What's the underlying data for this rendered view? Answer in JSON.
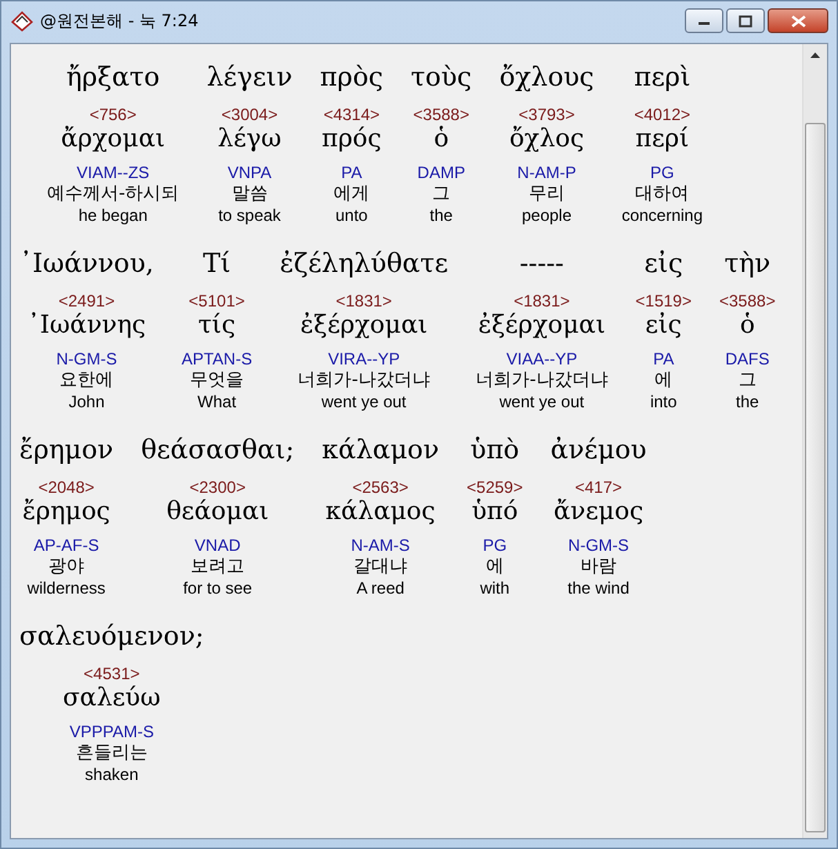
{
  "window": {
    "title": "@원전본해 - 눅 7:24"
  },
  "lines": [
    [
      {
        "greek": "ἤρξατο",
        "strong": "<756>",
        "lemma": "ἄρχομαι",
        "parsing": "VIAM--ZS",
        "korean": "예수께서-하시되",
        "english": "he began"
      },
      {
        "greek": "λέγειν",
        "strong": "<3004>",
        "lemma": "λέγω",
        "parsing": "VNPA",
        "korean": "말씀",
        "english": "to speak"
      },
      {
        "greek": "πρὸς",
        "strong": "<4314>",
        "lemma": "πρός",
        "parsing": "PA",
        "korean": "에게",
        "english": "unto"
      },
      {
        "greek": "τοὺς",
        "strong": "<3588>",
        "lemma": "ὁ",
        "parsing": "DAMP",
        "korean": "그",
        "english": "the"
      },
      {
        "greek": "ὄχλους",
        "strong": "<3793>",
        "lemma": "ὄχλος",
        "parsing": "N-AM-P",
        "korean": "무리",
        "english": "people"
      },
      {
        "greek": "περὶ",
        "strong": "<4012>",
        "lemma": "περί",
        "parsing": "PG",
        "korean": "대하여",
        "english": "concerning"
      }
    ],
    [
      {
        "greek": "᾽Ιωάννου,",
        "strong": "<2491>",
        "lemma": "᾽Ιωάννης",
        "parsing": "N-GM-S",
        "korean": "요한에",
        "english": "John"
      },
      {
        "greek": "Τί",
        "strong": "<5101>",
        "lemma": "τίς",
        "parsing": "APTAN-S",
        "korean": "무엇을",
        "english": "What"
      },
      {
        "greek": "ἐζέληλύθατε",
        "strong": "<1831>",
        "lemma": "ἐξέρχομαι",
        "parsing": "VIRA--YP",
        "korean": "너희가-나갔더냐",
        "english": "went ye out"
      },
      {
        "greek": "-----",
        "strong": "<1831>",
        "lemma": "ἐξέρχομαι",
        "parsing": "VIAA--YP",
        "korean": "너희가-나갔더냐",
        "english": "went ye out"
      },
      {
        "greek": "εἰς",
        "strong": "<1519>",
        "lemma": "εἰς",
        "parsing": "PA",
        "korean": "에",
        "english": "into"
      },
      {
        "greek": "τὴν",
        "strong": "<3588>",
        "lemma": "ὁ",
        "parsing": "DAFS",
        "korean": "그",
        "english": "the"
      }
    ],
    [
      {
        "greek": "ἔρημον",
        "strong": "<2048>",
        "lemma": "ἔρημος",
        "parsing": "AP-AF-S",
        "korean": "광야",
        "english": "wilderness"
      },
      {
        "greek": "θεάσασθαι;",
        "strong": "<2300>",
        "lemma": "θεάομαι",
        "parsing": "VNAD",
        "korean": "보려고",
        "english": "for to see"
      },
      {
        "greek": "κάλαμον",
        "strong": "<2563>",
        "lemma": "κάλαμος",
        "parsing": "N-AM-S",
        "korean": "갈대냐",
        "english": "A reed"
      },
      {
        "greek": "ὑπὸ",
        "strong": "<5259>",
        "lemma": "ὑπό",
        "parsing": "PG",
        "korean": "에",
        "english": "with"
      },
      {
        "greek": "ἀνέμου",
        "strong": "<417>",
        "lemma": "ἄνεμος",
        "parsing": "N-GM-S",
        "korean": "바람",
        "english": "the wind"
      }
    ],
    [
      {
        "greek": "σαλευόμενον;",
        "strong": "<4531>",
        "lemma": "σαλεύω",
        "parsing": "VPPPAM-S",
        "korean": "흔들리는",
        "english": "shaken"
      }
    ]
  ]
}
